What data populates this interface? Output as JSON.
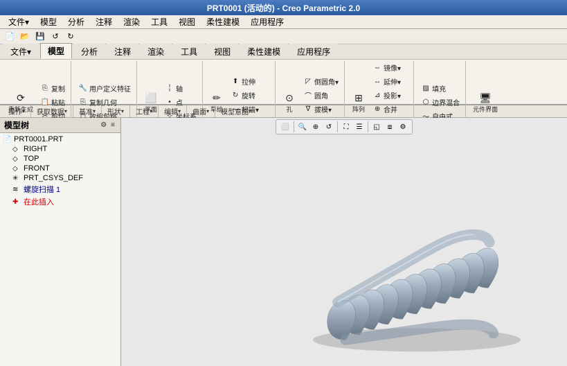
{
  "titleBar": {
    "text": "PRT0001 (活动的) - Creo Parametric 2.0"
  },
  "menuBar": {
    "items": [
      "文件▾",
      "模型",
      "分析",
      "注释",
      "渲染",
      "工具",
      "视图",
      "柔性建模",
      "应用程序"
    ]
  },
  "ribbonTabs": {
    "active": "模型",
    "items": [
      "文件▾",
      "模型",
      "分析",
      "注释",
      "渲染",
      "工具",
      "视图",
      "柔性建模",
      "应用程序"
    ]
  },
  "quickAccess": {
    "buttons": [
      "↺",
      "↻",
      "▣",
      "□",
      "📄"
    ]
  },
  "ribbonSections": {
    "labels": [
      "操作 ▾",
      "获取数据 ▾",
      "基准 ▾",
      "形状 ▾",
      "工程 ▾",
      "编辑 ▾",
      "曲面 ▾",
      "模型意图 ▾"
    ]
  },
  "ribbonGroups": {
    "group1": {
      "label": "操作",
      "buttons": [
        {
          "icon": "⟳",
          "text": "重新生成"
        },
        {
          "icon": "⎘",
          "text": "复制"
        },
        {
          "icon": "📋",
          "text": "粘贴"
        },
        {
          "icon": "✂",
          "text": "剪切"
        }
      ]
    }
  },
  "sidebar": {
    "title": "模型树",
    "toolbar": [
      "⚙",
      "≡"
    ],
    "items": [
      {
        "indent": 0,
        "icon": "📄",
        "text": "PRT0001.PRT",
        "type": "root"
      },
      {
        "indent": 1,
        "icon": "◇",
        "text": "RIGHT",
        "type": "datum"
      },
      {
        "indent": 1,
        "icon": "◇",
        "text": "TOP",
        "type": "datum"
      },
      {
        "indent": 1,
        "icon": "◇",
        "text": "FRONT",
        "type": "datum"
      },
      {
        "indent": 1,
        "icon": "✳",
        "text": "PRT_CSYS_DEF",
        "type": "csys"
      },
      {
        "indent": 1,
        "icon": "≋",
        "text": "螺旋扫描 1",
        "type": "feature"
      },
      {
        "indent": 1,
        "icon": "✚",
        "text": "在此插入",
        "type": "insert"
      }
    ]
  },
  "viewport": {
    "toolbarButtons": [
      "□",
      "⊕",
      "🔍",
      "↺",
      "⛶",
      "⊞",
      "◱",
      "⟲",
      "⚙"
    ],
    "separatorAfter": [
      1,
      4,
      6
    ]
  },
  "spring": {
    "description": "Helical sweep coil spring 3D model",
    "color": "#8a9ab0",
    "highlightColor": "#c0ccd8",
    "shadowColor": "#5a6878"
  }
}
